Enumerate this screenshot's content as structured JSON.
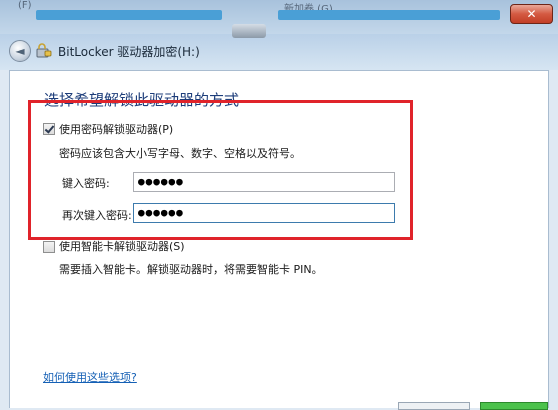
{
  "background": {
    "left_text": "(F)",
    "right_text": "新加卷 (G)"
  },
  "window": {
    "title": "BitLocker 驱动器加密(H:)",
    "close_glyph": "✕",
    "back_glyph": "◄"
  },
  "main": {
    "heading": "选择希望解锁此驱动器的方式",
    "password_option": {
      "label": "使用密码解锁驱动器(P)",
      "checked": true,
      "description": "密码应该包含大小写字母、数字、空格以及符号。",
      "enter_label": "键入密码:",
      "enter_value": "●●●●●●",
      "reenter_label": "再次键入密码:",
      "reenter_value": "●●●●●●"
    },
    "smartcard_option": {
      "label": "使用智能卡解锁驱动器(S)",
      "checked": false,
      "description": "需要插入智能卡。解锁驱动器时，将需要智能卡 PIN。"
    },
    "help_link": "如何使用这些选项?"
  },
  "colors": {
    "highlight_border": "#e0232a",
    "heading": "#1d3d7a",
    "link": "#1560b5"
  }
}
